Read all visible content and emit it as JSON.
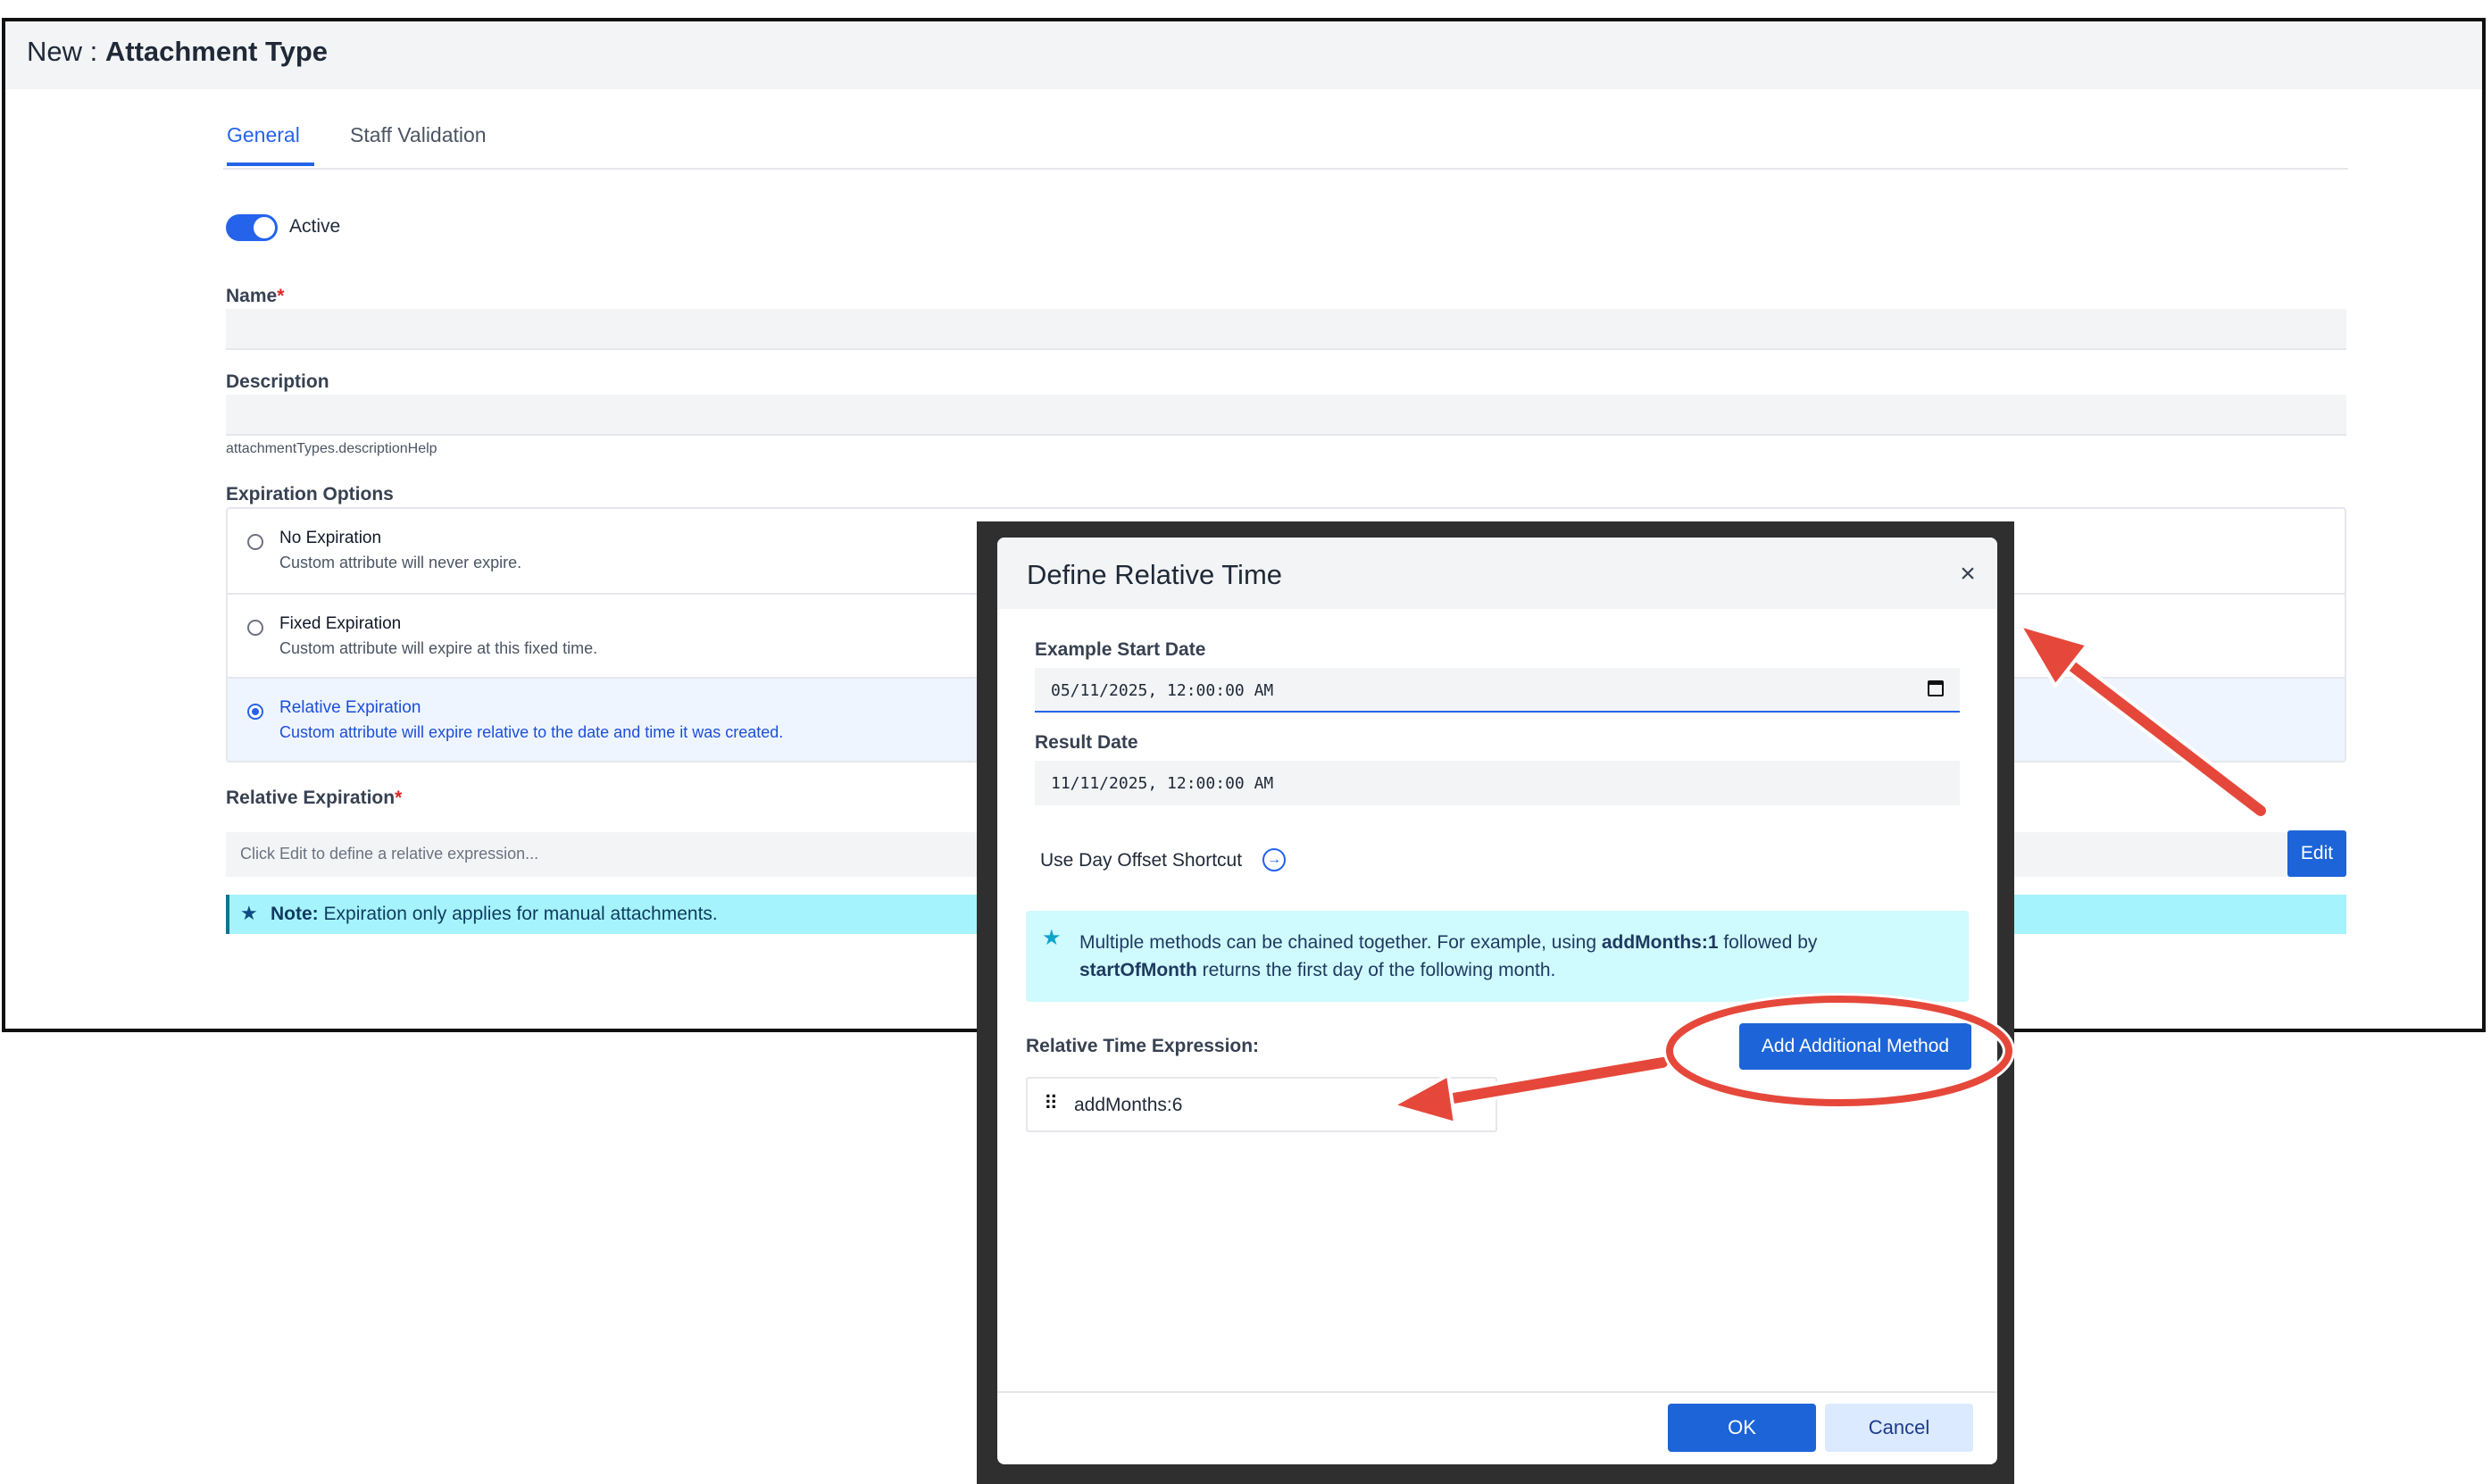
{
  "page": {
    "title_prefix": "New : ",
    "title_entity": "Attachment Type",
    "tabs": [
      {
        "label": "General",
        "active": true
      },
      {
        "label": "Staff Validation",
        "active": false
      }
    ],
    "active_toggle_label": "Active",
    "name_label": "Name",
    "required_mark": "*",
    "description_label": "Description",
    "description_help": "attachmentTypes.descriptionHelp",
    "expiration_options_label": "Expiration Options",
    "expiration_options": [
      {
        "title": "No Expiration",
        "desc": "Custom attribute will never expire.",
        "selected": false
      },
      {
        "title": "Fixed Expiration",
        "desc": "Custom attribute will expire at this fixed time.",
        "selected": false
      },
      {
        "title": "Relative Expiration",
        "desc": "Custom attribute will expire relative to the date and time it was created.",
        "selected": true
      }
    ],
    "relative_expiration_label": "Relative Expiration",
    "relative_expiration_placeholder": "Click Edit to define a relative expression...",
    "edit_label": "Edit",
    "note_bold": "Note:",
    "note_text": " Expiration only applies for manual attachments."
  },
  "modal": {
    "title": "Define Relative Time",
    "close_glyph": "×",
    "start_date_label": "Example Start Date",
    "start_date_value": "05/11/2025, 12:00:00 AM",
    "result_date_label": "Result Date",
    "result_date_value": "11/11/2025, 12:00:00 AM",
    "shortcut_label": "Use Day Offset Shortcut",
    "info": {
      "part1": "Multiple methods can be chained together. For example, using ",
      "bold1": "addMonths:1",
      "part2": " followed by ",
      "bold2": "startOfMonth",
      "part3": " returns the first day of the following month."
    },
    "expression_label": "Relative Time Expression:",
    "add_method_label": "Add Additional Method",
    "expressions": [
      "addMonths:6"
    ],
    "ok_label": "OK",
    "cancel_label": "Cancel"
  },
  "colors": {
    "primary": "#1d64d8",
    "annotation": "#e5483b",
    "info_bg": "#cffafe",
    "note_bg": "#a5f3fc"
  },
  "icons": [
    "close-icon",
    "calendar-icon",
    "arrow-right-circle-icon",
    "star-icon",
    "drag-handle-icon"
  ]
}
